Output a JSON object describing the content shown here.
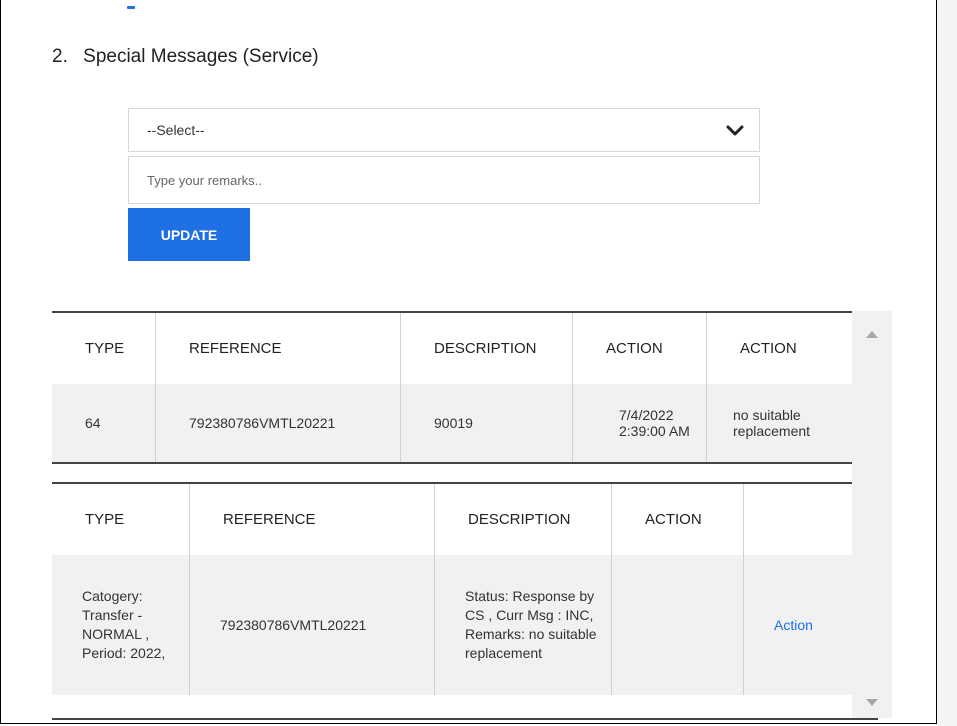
{
  "section": {
    "number": "2.",
    "title": "Special Messages (Service)"
  },
  "form": {
    "select_value": "--Select--",
    "remarks_placeholder": "Type your remarks..",
    "update_label": "UPDATE"
  },
  "table1": {
    "headers": [
      "TYPE",
      "REFERENCE",
      "DESCRIPTION",
      "ACTION",
      "ACTION"
    ],
    "rows": [
      [
        "64",
        "792380786VMTL20221",
        "90019",
        "7/4/2022 2:39:00 AM",
        "no suitable replacement"
      ]
    ]
  },
  "table2": {
    "headers": [
      "TYPE",
      "REFERENCE",
      "DESCRIPTION",
      "ACTION",
      ""
    ],
    "rows": [
      [
        "Catogery: Transfer - NORMAL , Period: 2022,",
        "792380786VMTL20221",
        "Status: Response by CS , Curr Msg : INC, Remarks: no suitable replacement",
        "",
        "Action"
      ]
    ]
  },
  "colors": {
    "accent": "#1f6fe5",
    "row_bg": "#f1f1f1"
  },
  "icons": {
    "select_chevron": "chevron-down-icon",
    "scroll_up": "scroll-up-arrow-icon",
    "scroll_down": "scroll-down-arrow-icon"
  }
}
